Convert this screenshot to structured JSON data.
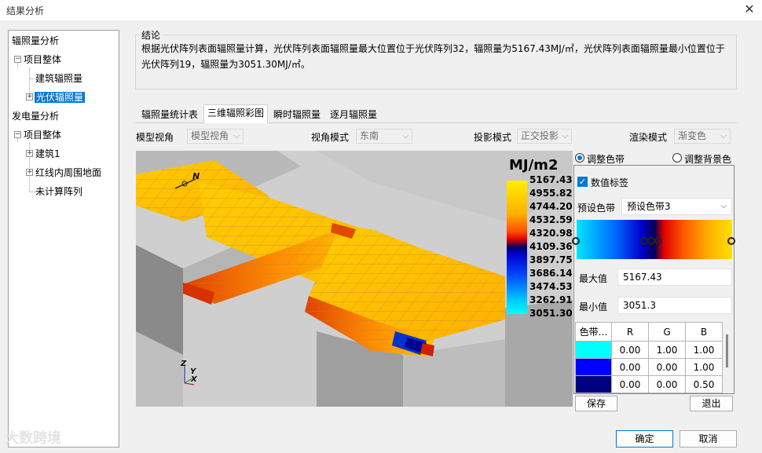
{
  "window": {
    "title": "结果分析",
    "close_glyph": "✕"
  },
  "tree": {
    "items": [
      {
        "label": "辐照量分析"
      },
      {
        "label": "项目整体"
      },
      {
        "label": "建筑辐照量"
      },
      {
        "label": "光伏辐照量"
      },
      {
        "label": "发电量分析"
      },
      {
        "label": "项目整体"
      },
      {
        "label": "建筑1"
      },
      {
        "label": "红线内周围地面"
      },
      {
        "label": "未计算阵列"
      }
    ]
  },
  "conclusion": {
    "label": "结论",
    "text": "根据光伏阵列表面辐照量计算，光伏阵列表面辐照量最大位置位于光伏阵列32，辐照量为5167.43MJ/㎡，光伏阵列表面辐照量最小位置位于光伏阵列19，辐照量为3051.30MJ/㎡。"
  },
  "tabs": [
    "辐照量统计表",
    "三维辐照彩图",
    "瞬时辐照量",
    "逐月辐照量"
  ],
  "options": {
    "model_view": {
      "label": "模型视角",
      "value": "模型视角"
    },
    "view_mode": {
      "label": "视角模式",
      "value": "东南"
    },
    "projection": {
      "label": "投影模式",
      "value": "正交投影"
    },
    "render": {
      "label": "渲染模式",
      "value": "渐变色"
    }
  },
  "viewport": {
    "compass": "N",
    "axes": {
      "z": "Z",
      "y": "Y",
      "x": "X"
    }
  },
  "legend": {
    "title": "MJ/m2",
    "ticks": [
      "5167.43",
      "4955.82",
      "4744.20",
      "4532.59",
      "4320.98",
      "4109.36",
      "3897.75",
      "3686.14",
      "3474.53",
      "3262.91",
      "3051.30"
    ]
  },
  "panel": {
    "radio_band": "调整色带",
    "radio_bg": "调整背景色",
    "value_label": "数值标签",
    "preset_label": "预设色带",
    "preset_value": "预设色带3",
    "max_label": "最大值",
    "max_value": "5167.43",
    "min_label": "最小值",
    "min_value": "3051.3",
    "table_headers": [
      "色带…",
      "R",
      "G",
      "B"
    ],
    "table_rows": [
      {
        "color": "#00ffff",
        "r": "0.00",
        "g": "1.00",
        "b": "1.00"
      },
      {
        "color": "#0000ff",
        "r": "0.00",
        "g": "0.00",
        "b": "1.00"
      },
      {
        "color": "#000080",
        "r": "0.00",
        "g": "0.00",
        "b": "0.50"
      }
    ]
  },
  "buttons": {
    "save": "保存",
    "exit": "退出",
    "ok": "确定",
    "cancel": "取消"
  },
  "watermark": "大数跨境",
  "colors": {
    "selection": "#0078d7",
    "panel_bg": "#f0f0f0"
  }
}
